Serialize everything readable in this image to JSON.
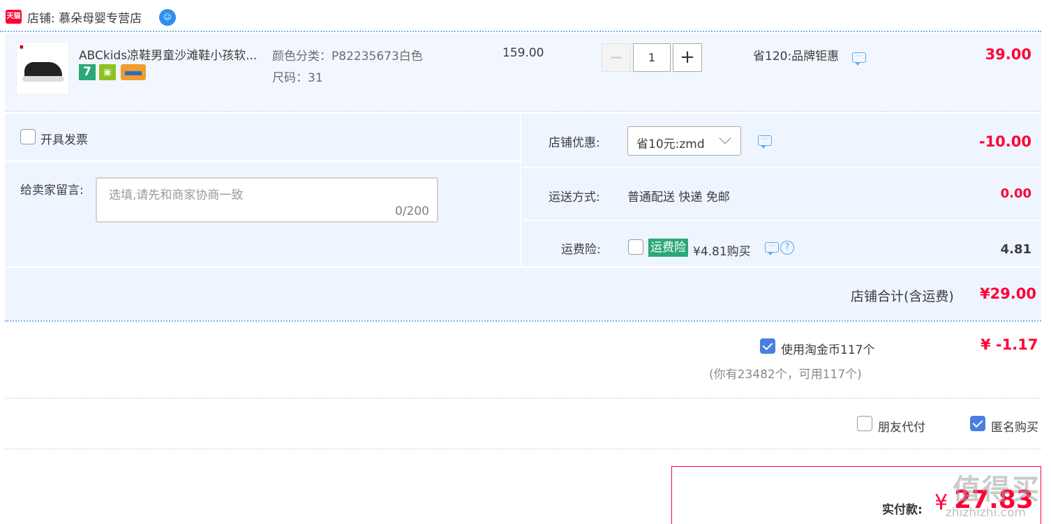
{
  "shop": {
    "badge": "天猫",
    "label": "店铺: 慕朵母婴专营店"
  },
  "product": {
    "title": "ABCkids凉鞋男童沙滩鞋小孩软...",
    "tag_7": "7",
    "sku_color": "颜色分类：P82235673白色",
    "sku_size": "尺码：31",
    "unit_price": "159.00",
    "quantity": "1",
    "qty_minus": "−",
    "qty_plus": "+",
    "promo": "省120:品牌钜惠",
    "line_total": "39.00"
  },
  "invoice": {
    "label": "开具发票"
  },
  "message": {
    "label": "给卖家留言:",
    "placeholder": "选填,请先和商家协商一致",
    "count": "0/200"
  },
  "shop_discount": {
    "label": "店铺优惠:",
    "selected": "省10元:zmd",
    "amount": "-10.00"
  },
  "shipping": {
    "label": "运送方式:",
    "method": "普通配送 快递 免邮",
    "amount": "0.00"
  },
  "insurance": {
    "label": "运费险:",
    "badge": "运费险",
    "text": "¥4.81购买",
    "help": "?",
    "amount": "4.81"
  },
  "shop_total": {
    "label": "店铺合计(含运费)",
    "amount": "¥29.00"
  },
  "coins": {
    "label": "使用淘金币117个",
    "note": "(你有23482个，可用117个)",
    "amount": "¥ -1.17"
  },
  "options": {
    "friend_pay": "朋友代付",
    "anonymous": "匿名购买"
  },
  "payment": {
    "label": "实付款:",
    "currency": "¥",
    "amount": "27.83"
  },
  "watermark": {
    "text": "值得买",
    "url": "zhizhizhi.com"
  },
  "colors": {
    "accent_red": "#ff0036",
    "panel_blue": "#eef5ff",
    "check_blue": "#4a7fe0",
    "badge_green": "#2aa876"
  }
}
